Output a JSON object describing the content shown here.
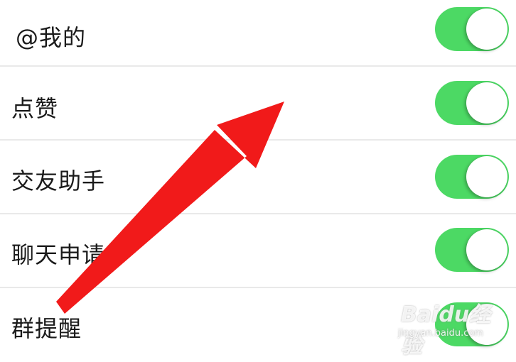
{
  "settings": {
    "items": [
      {
        "label": "@我的",
        "enabled": true
      },
      {
        "label": "点赞",
        "enabled": true
      },
      {
        "label": "交友助手",
        "enabled": true
      },
      {
        "label": "聊天申请",
        "enabled": true
      },
      {
        "label": "群提醒",
        "enabled": true
      }
    ]
  },
  "colors": {
    "toggle_on": "#4cd964",
    "arrow": "#f11a1a",
    "divider": "#e9e9e9"
  },
  "watermark": {
    "brand": "Baidu经验",
    "url": "jingyan.baidu.com"
  }
}
